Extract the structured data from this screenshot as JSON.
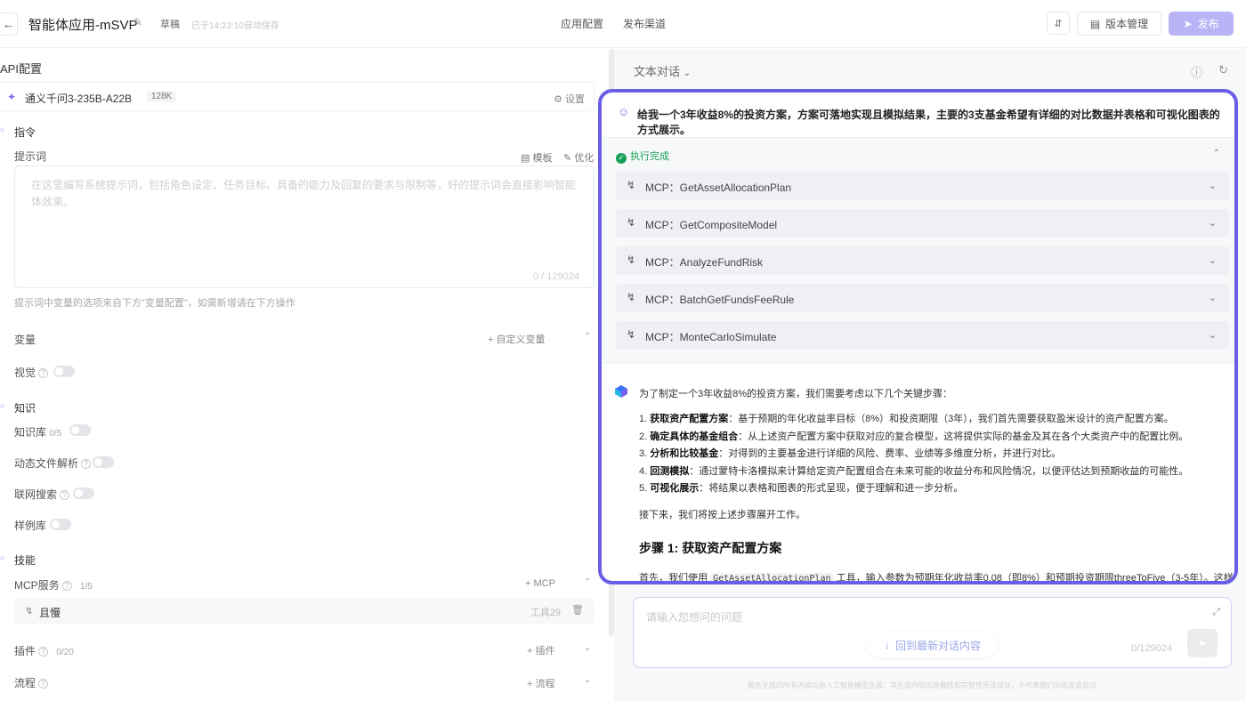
{
  "header": {
    "title": "智能体应用-mSVP",
    "draft": "草稿",
    "autosave": "已于14:23:10自动保存",
    "tabs": [
      "应用配置",
      "发布渠道"
    ],
    "version_btn": "版本管理",
    "publish_btn": "发布"
  },
  "left": {
    "section_title": "API配置",
    "model": {
      "name": "通义千问3-235B-A22B",
      "ctx": "128K",
      "settings": "设置"
    },
    "instructions": "指令",
    "prompt_label": "提示词",
    "template": "模板",
    "optimize": "优化",
    "prompt_placeholder": "在这里编写系统提示词，包括角色设定、任务目标、具备的能力及回复的要求与限制等，好的提示词会直接影响智能体效果。",
    "prompt_count": "0 / 129024",
    "prompt_hint": "提示词中变量的选项来自下方\"变量配置\"，如需新增请在下方操作",
    "variables": "变量",
    "custom_variable": "自定义变量",
    "vision": "视觉",
    "knowledge": "知识",
    "kb": "知识库",
    "kb_count": "0/5",
    "dynamic_file": "动态文件解析",
    "web_search": "联网搜索",
    "sample_lib": "样例库",
    "skills": "技能",
    "mcp_service": "MCP服务",
    "mcp_count": "1/5",
    "mcp_add": "MCP",
    "tool_name": "且慢",
    "tool_count": "工具29",
    "plugins": "插件",
    "plugin_count": "0/20",
    "plugin_add": "插件",
    "flow": "流程",
    "flow_add": "流程"
  },
  "right": {
    "mode": "文本对话",
    "question": "给我一个3年收益8%的投资方案，方案可落地实现且模拟结果，主要的3支基金希望有详细的对比数据并表格和可视化图表的方式展示。",
    "exec_status": "执行完成",
    "mcp_calls": [
      "MCP：GetAssetAllocationPlan",
      "MCP：GetCompositeModel",
      "MCP：AnalyzeFundRisk",
      "MCP：BatchGetFundsFeeRule",
      "MCP：MonteCarloSimulate"
    ],
    "answer_intro": "为了制定一个3年收益8%的投资方案，我们需要考虑以下几个关键步骤：",
    "steps": [
      {
        "num": "1.",
        "title": "获取资产配置方案",
        "desc": "：基于预期的年化收益率目标（8%）和投资期限（3年），我们首先需要获取盈米设计的资产配置方案。"
      },
      {
        "num": "2.",
        "title": "确定具体的基金组合",
        "desc": "：从上述资产配置方案中获取对应的复合模型，这将提供实际的基金及其在各个大类资产中的配置比例。"
      },
      {
        "num": "3.",
        "title": "分析和比较基金",
        "desc": "：对得到的主要基金进行详细的风险、费率、业绩等多维度分析，并进行对比。"
      },
      {
        "num": "4.",
        "title": "回测模拟",
        "desc": "：通过蒙特卡洛模拟来计算给定资产配置组合在未来可能的收益分布和风险情况，以便评估达到预期收益的可能性。"
      },
      {
        "num": "5.",
        "title": "可视化展示",
        "desc": "：将结果以表格和图表的形式呈现，便于理解和进一步分析。"
      }
    ],
    "next": "接下来，我们将按上述步骤展开工作。",
    "step_heading": "步骤 1: 获取资产配置方案",
    "para_pre": "首先，我们使用",
    "para_code": "GetAssetAllocationPlan",
    "para_post": "工具，输入参数为预期年化收益率0.08（即8%）和预期投资期限threeToFive（3-5年）。这样",
    "input_placeholder": "请输入您想问的问题",
    "input_count": "0/129024",
    "latest": "回到最新对话内容",
    "disclaimer": "服务生成的所有内容均由人工智能模型生成，其生成内容的准确性和完整性无法保证，不代表我们的态度或观点"
  },
  "colors": {
    "accent": "#6b5ee6",
    "publish": "#b9b4f5",
    "success": "#18a058"
  }
}
